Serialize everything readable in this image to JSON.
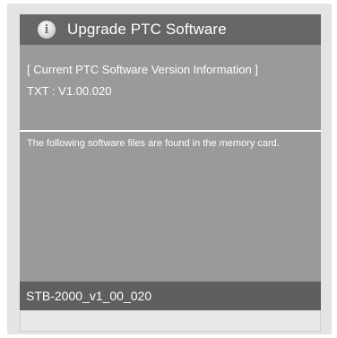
{
  "dialog": {
    "title": "Upgrade PTC Software",
    "icon": "info-icon"
  },
  "info": {
    "heading": "[ Current PTC Software Version Information ]",
    "version_line": "TXT : V1.00.020"
  },
  "message": "The following software files are found in the memory card.",
  "files": [
    {
      "name": "STB-2000_v1_00_020"
    }
  ]
}
